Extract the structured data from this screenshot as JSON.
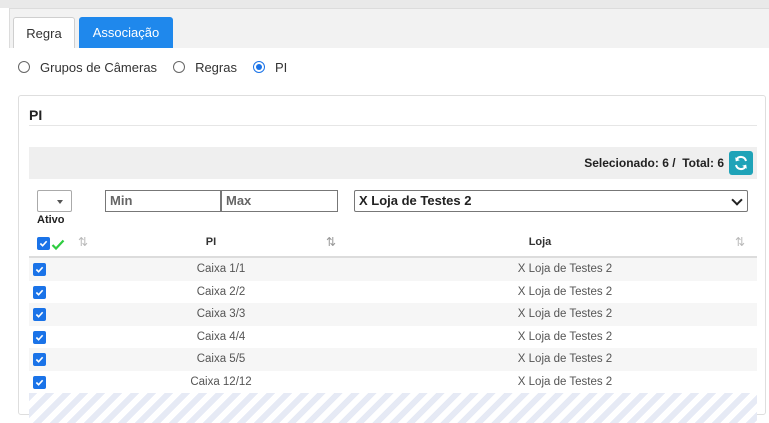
{
  "tabs": [
    {
      "label": "Regra",
      "active": false
    },
    {
      "label": "Associação",
      "active": true
    }
  ],
  "radio_group": {
    "options": [
      "Grupos de Câmeras",
      "Regras",
      "PI"
    ],
    "selected": "PI"
  },
  "panel": {
    "title": "PI",
    "status": "Selecionado: 6 /  Total: 6",
    "refresh_icon": "refresh-icon"
  },
  "filters": {
    "min_placeholder": "Min",
    "max_placeholder": "Max",
    "loja_value": "X Loja de Testes 2"
  },
  "table": {
    "ativo_label": "Ativo",
    "columns": {
      "pi": "PI",
      "loja": "Loja"
    },
    "rows": [
      {
        "pi": "Caixa 1/1",
        "loja": "X Loja de Testes 2",
        "checked": true
      },
      {
        "pi": "Caixa 2/2",
        "loja": "X Loja de Testes 2",
        "checked": true
      },
      {
        "pi": "Caixa 3/3",
        "loja": "X Loja de Testes 2",
        "checked": true
      },
      {
        "pi": "Caixa 4/4",
        "loja": "X Loja de Testes 2",
        "checked": true
      },
      {
        "pi": "Caixa 5/5",
        "loja": "X Loja de Testes 2",
        "checked": true
      },
      {
        "pi": "Caixa 12/12",
        "loja": "X Loja de Testes 2",
        "checked": true
      }
    ]
  },
  "colors": {
    "accent": "#1f88ec",
    "refresh": "#1fa3b8",
    "check_green": "#2ecc40"
  }
}
